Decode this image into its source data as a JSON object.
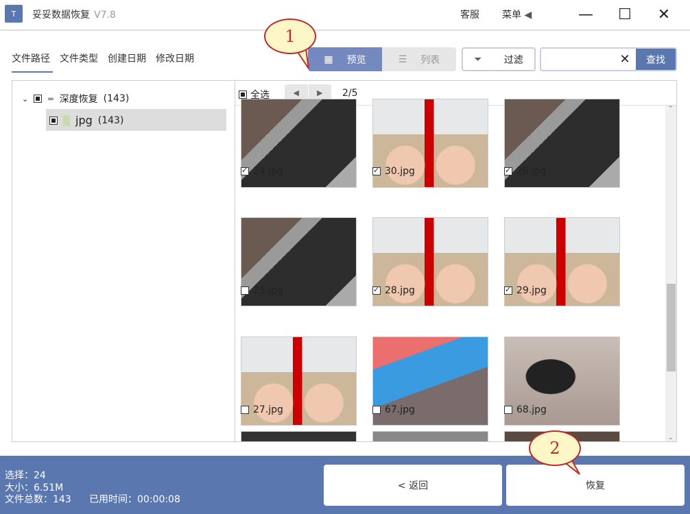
{
  "app": {
    "title": "妥妥数据恢复",
    "version": "V7.8",
    "logo_text": "T"
  },
  "titlebar": {
    "service": "客服",
    "menu": "菜单",
    "menu_arrow": "◀",
    "minimize": "—",
    "maximize": "☐",
    "close": "✕"
  },
  "tabs": [
    "文件路径",
    "文件类型",
    "创建日期",
    "修改日期"
  ],
  "toolbar": {
    "preview": "预览",
    "list": "列表",
    "filter": "过滤",
    "search_value": "",
    "search_clear": "✕",
    "search_btn": "查找"
  },
  "tree": [
    {
      "label": "深度恢复",
      "count": "(143)"
    },
    {
      "label": "jpg",
      "count": "(143)"
    }
  ],
  "grid": {
    "select_all": "全选",
    "page": "2/5",
    "prev": "◀",
    "next": "▶",
    "items": [
      {
        "name": "24.jpg",
        "checked": true,
        "kind": "laptop"
      },
      {
        "name": "30.jpg",
        "checked": true,
        "kind": "fists"
      },
      {
        "name": "26.jpg",
        "checked": true,
        "kind": "laptop"
      },
      {
        "name": "25.jpg",
        "checked": false,
        "kind": "laptop"
      },
      {
        "name": "28.jpg",
        "checked": true,
        "kind": "fists"
      },
      {
        "name": "29.jpg",
        "checked": true,
        "kind": "fists"
      },
      {
        "name": "27.jpg",
        "checked": false,
        "kind": "fists"
      },
      {
        "name": "67.jpg",
        "checked": false,
        "kind": "notes"
      },
      {
        "name": "68.jpg",
        "checked": false,
        "kind": "hdd"
      }
    ]
  },
  "status": {
    "selected": "选择：24",
    "size": "大小：6.51M",
    "total": "文件总数：143",
    "elapsed": "已用时间：00:00:08"
  },
  "buttons": {
    "back": "< 返回",
    "recover": "恢复"
  },
  "callouts": [
    "1",
    "2"
  ],
  "colors": {
    "accent": "#5a77b0"
  }
}
